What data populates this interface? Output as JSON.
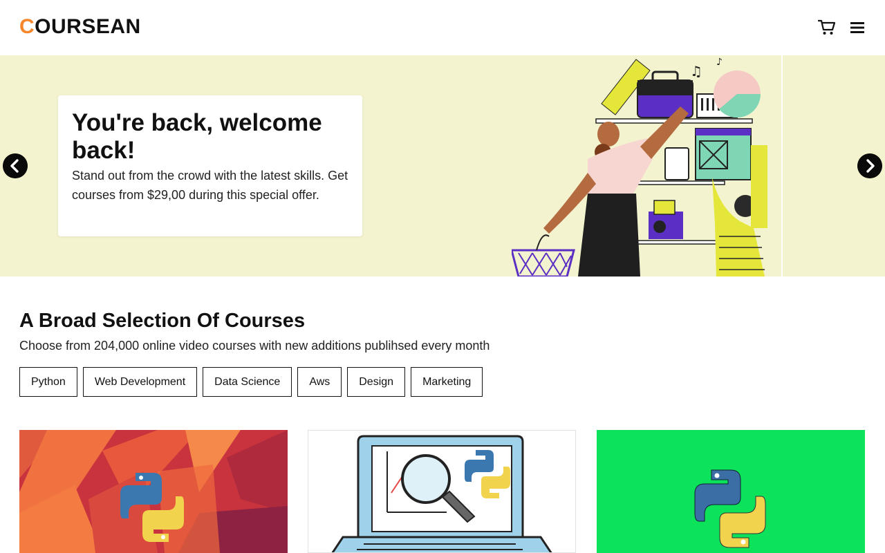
{
  "header": {
    "logo_first_letter": "C",
    "logo_rest": "OURSEAN",
    "accent_color": "#f5872a",
    "cart_icon": "cart-icon",
    "menu_icon": "hamburger-menu-icon"
  },
  "hero": {
    "title": "You're back, welcome back!",
    "text": "Stand out from the crowd with the latest skills. Get courses from $29,00 during this special offer.",
    "background_color": "#f3f3cf",
    "prev_icon": "chevron-left-icon",
    "next_icon": "chevron-right-icon"
  },
  "courses": {
    "title": "A Broad Selection Of Courses",
    "subtitle": "Choose from 204,000 online video courses with new additions publihsed every month",
    "tags": [
      "Python",
      "Web Development",
      "Data Science",
      "Aws",
      "Design",
      "Marketing"
    ],
    "cards": [
      {
        "image": "python-logo-red-polygon-thumbnail"
      },
      {
        "image": "laptop-data-analysis-python-thumbnail"
      },
      {
        "image": "python-logo-green-thumbnail"
      }
    ]
  }
}
